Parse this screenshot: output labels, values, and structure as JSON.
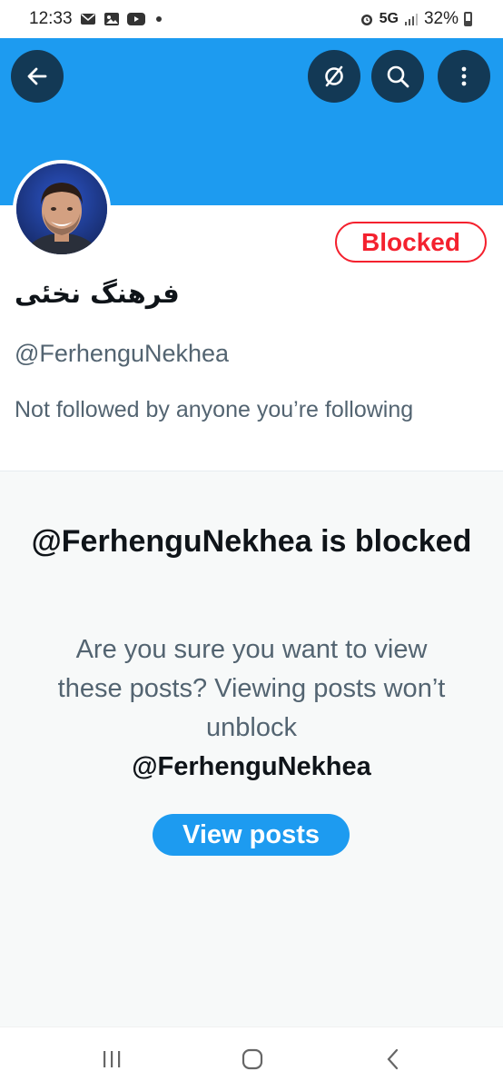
{
  "status_bar": {
    "time": "12:33",
    "network": "5G",
    "battery": "32%",
    "icons": [
      "mail-icon",
      "gallery-icon",
      "youtube-icon",
      "notification-dot",
      "alarm-icon",
      "signal-icon",
      "battery-icon"
    ]
  },
  "toolbar": {
    "back_icon": "arrow-left-icon",
    "grok_icon": "grok-icon",
    "search_icon": "search-icon",
    "more_icon": "more-vertical-icon"
  },
  "colors": {
    "banner": "#1d9bf0",
    "blocked": "#f4212e",
    "accent": "#1d9bf0",
    "secondary_text": "#536471",
    "panel_bg": "#f7f9f9"
  },
  "profile": {
    "display_name": "فرهنگ نخئی",
    "handle": "@FerhenguNekhea",
    "blocked_label": "Blocked",
    "followers_note": "Not followed by anyone you’re following"
  },
  "blocked_panel": {
    "title": "@FerhenguNekhea is blocked",
    "body": "Are you sure you want to view these posts? Viewing posts won’t unblock",
    "body_handle": "@FerhenguNekhea",
    "button_label": "View posts"
  },
  "nav_bar": {
    "recents_icon": "recents-icon",
    "home_icon": "home-icon",
    "back_icon": "back-chevron-icon"
  }
}
